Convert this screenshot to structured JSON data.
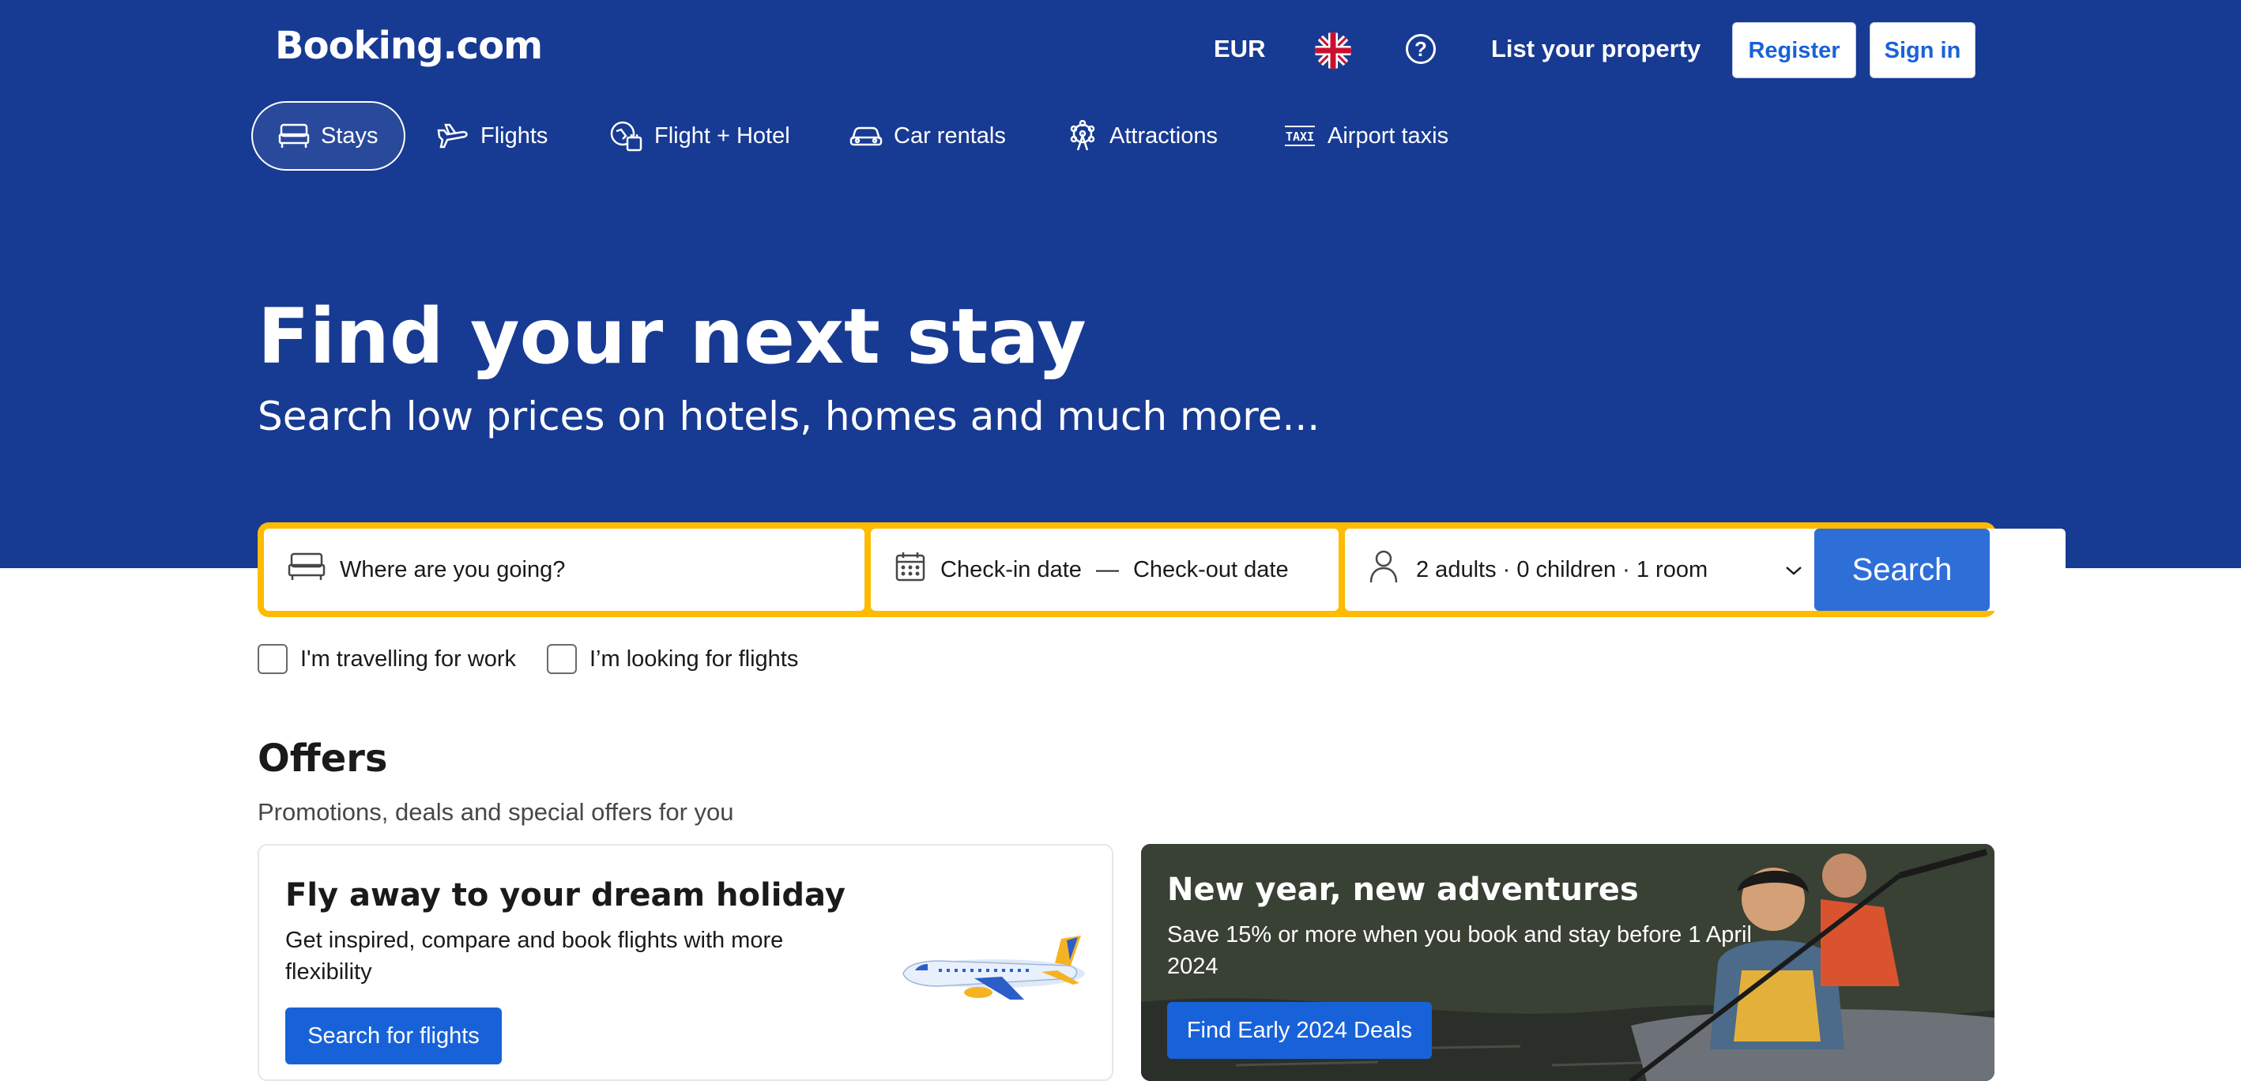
{
  "header": {
    "logo": "Booking.com",
    "currency": "EUR",
    "list_property": "List your property",
    "register": "Register",
    "sign_in": "Sign in",
    "help_glyph": "?"
  },
  "nav": {
    "items": [
      {
        "label": "Stays",
        "icon": "bed-icon",
        "active": true
      },
      {
        "label": "Flights",
        "icon": "plane-icon"
      },
      {
        "label": "Flight + Hotel",
        "icon": "flight-hotel-icon"
      },
      {
        "label": "Car rentals",
        "icon": "car-icon"
      },
      {
        "label": "Attractions",
        "icon": "ferris-wheel-icon"
      },
      {
        "label": "Airport taxis",
        "icon": "taxi-icon"
      }
    ]
  },
  "hero": {
    "title": "Find your next stay",
    "subtitle": "Search low prices on hotels, homes and much more..."
  },
  "search": {
    "destination_placeholder": "Where are you going?",
    "checkin": "Check-in date",
    "dash": "—",
    "checkout": "Check-out date",
    "guests": "2 adults · 0 children · 1 room",
    "button": "Search",
    "accent_color": "#febb02"
  },
  "checkboxes": {
    "work": "I'm travelling for work",
    "flights": "I’m looking for flights"
  },
  "offers": {
    "title": "Offers",
    "subtitle": "Promotions, deals and special offers for you",
    "card1": {
      "title": "Fly away to your dream holiday",
      "text": "Get inspired, compare and book flights with more flexibility",
      "button": "Search for flights"
    },
    "card2": {
      "title": "New year, new adventures",
      "text": "Save 15% or more when you book and stay before 1 April 2024",
      "button": "Find Early 2024 Deals"
    }
  },
  "colors": {
    "brand": "#173a93",
    "primary_button": "#1862d9",
    "search_button": "#2e6ed7"
  }
}
